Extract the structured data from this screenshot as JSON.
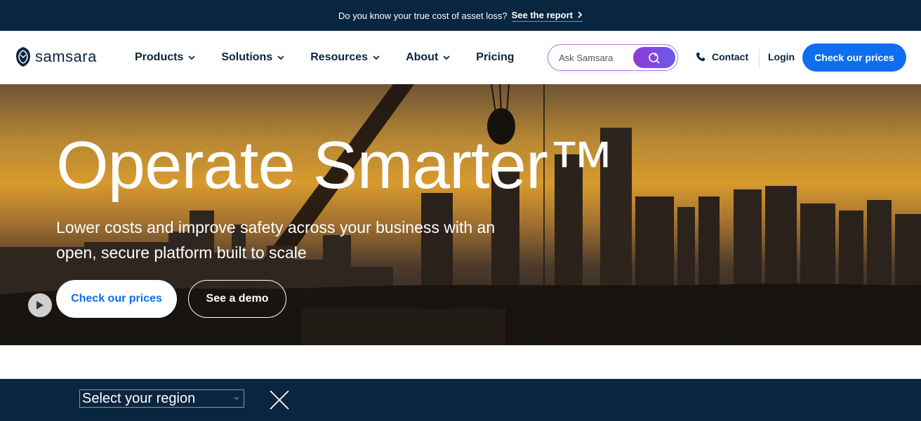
{
  "announcement": {
    "text": "Do you know your true cost of asset loss?",
    "link_label": "See the report",
    "link_chevron": "›"
  },
  "header": {
    "logo_text": "samsara",
    "nav": [
      {
        "label": "Products",
        "has_dropdown": true
      },
      {
        "label": "Solutions",
        "has_dropdown": true
      },
      {
        "label": "Resources",
        "has_dropdown": true
      },
      {
        "label": "About",
        "has_dropdown": true
      },
      {
        "label": "Pricing",
        "has_dropdown": false
      }
    ],
    "search_placeholder": "Ask Samsara",
    "contact_label": "Contact",
    "login_label": "Login",
    "cta_label": "Check our prices"
  },
  "hero": {
    "title": "Operate Smarter™",
    "subtitle": "Lower costs and improve safety across your business with an open, secure platform built to scale",
    "primary_button": "Check our prices",
    "secondary_button": "See a demo"
  },
  "region_bar": {
    "select_value": "Select your region"
  },
  "colors": {
    "navy": "#0a2540",
    "brand_blue": "#0d6ef0",
    "search_gradient_start": "#8e3ad6",
    "search_gradient_end": "#6a5be8"
  },
  "icons": [
    "samsara-logo-icon",
    "chevron-down-icon",
    "search-sparkle-icon",
    "phone-icon",
    "play-icon",
    "close-icon"
  ]
}
